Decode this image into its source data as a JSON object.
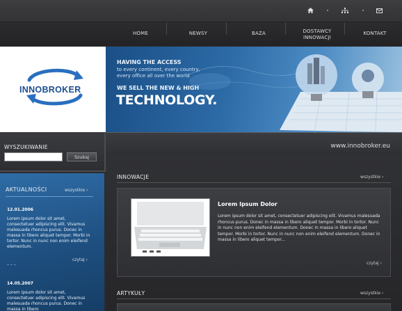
{
  "top_icons": [
    "home-icon",
    "sitemap-icon",
    "mail-icon"
  ],
  "nav": {
    "items": [
      {
        "label": "HOME"
      },
      {
        "label": "NEWSY"
      },
      {
        "label": "BAZA"
      },
      {
        "label_line1": "DOSTAWCY",
        "label_line2": "INNOWACJI"
      },
      {
        "label": "KONTAKT"
      }
    ]
  },
  "logo": {
    "text": "INNOBROKER"
  },
  "banner": {
    "line1": "HAVING THE ACCESS",
    "line2": "to every continent, every country,",
    "line3": "every office all over the world",
    "line4": "WE SELL THE NEW & HIGH",
    "headline": "TECHNOLOGY.",
    "url": "www.innobroker.eu"
  },
  "search": {
    "title": "WYSZUKIWANIE",
    "input_value": "",
    "button_label": "Szukaj"
  },
  "news": {
    "title": "AKTUALNOŚCI",
    "all_label": "wszystkie",
    "items": [
      {
        "date": "12.01.2006",
        "text": "Lorem ipsum dolor sit amet, consectetuer adipiscing elit. Vivamus malesuada rhoncus purus. Donec in massa in libero aliquet tempor. Morbi in tortor. Nunc in nunc non enim eleifend elementum.",
        "more": "czytaj"
      },
      {
        "date": "14.05.2007",
        "text": "Lorem ipsum dolor sit amet, consectetuer adipiscing elit. Vivamus malesuada rhoncus purus. Donec in massa in libero"
      }
    ]
  },
  "innovations": {
    "title": "INNOWACJE",
    "all_label": "wszystkie",
    "article_title": "Lorem Ipsum Dolor",
    "article_text": "Lorem ipsum dolor sit amet, consectetuer adipiscing elit. Vivamus malesuada rhoncus purus. Donec in massa in libero aliquet tempor. Morbi in tortor. Nunc in nunc non enim eleifend elementum. Donec in massa in libero aliquet tempor. Morbi in tortor. Nunc in nunc non enim eleifend elementum. Donec in massa in libero aliquet tempor...",
    "more": "czytaj"
  },
  "articles": {
    "title": "ARTYKUŁY",
    "all_label": "wszystkie"
  },
  "colors": {
    "accent_blue": "#2a6aa6",
    "dark_bg": "#2b2b2d"
  }
}
